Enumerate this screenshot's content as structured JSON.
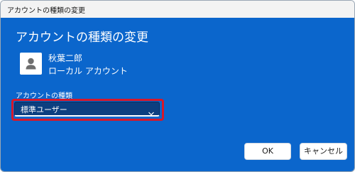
{
  "window": {
    "title": "アカウントの種類の変更"
  },
  "dialog": {
    "heading": "アカウントの種類の変更",
    "user": {
      "name": "秋葉二郎",
      "account_kind": "ローカル アカウント",
      "avatar_icon": "user-avatar-icon"
    },
    "account_type_label": "アカウントの種類",
    "account_type_dropdown": {
      "selected": "標準ユーザー",
      "icon": "chevron-down-icon"
    },
    "buttons": {
      "ok": "OK",
      "cancel": "キャンセル"
    }
  },
  "colors": {
    "content_background": "#0b66cc",
    "dropdown_background": "#0c3f80",
    "highlight_border": "#d6182a",
    "titlebar_background": "#f3f3f3"
  }
}
